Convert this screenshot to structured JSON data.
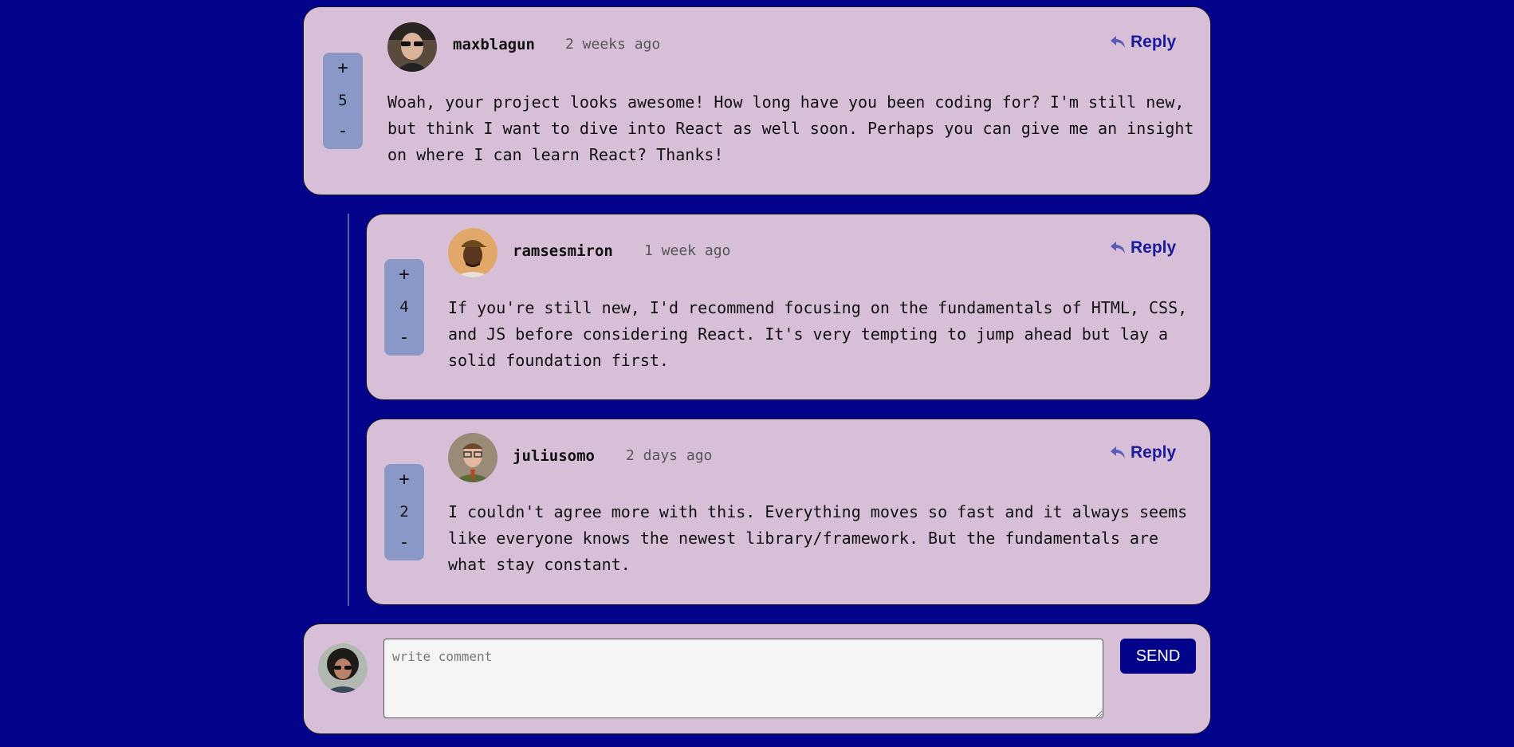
{
  "comments": [
    {
      "username": "maxblagun",
      "timestamp": "2 weeks ago",
      "score": "5",
      "upvote": "+",
      "downvote": "-",
      "reply_label": "Reply",
      "content": "Woah, your project looks awesome! How long have you been coding for? I'm still new, but think I want to dive into React as well soon. Perhaps you can give me an insight on where I can learn React? Thanks!"
    }
  ],
  "replies": [
    {
      "username": "ramsesmiron",
      "timestamp": "1 week ago",
      "score": "4",
      "upvote": "+",
      "downvote": "-",
      "reply_label": "Reply",
      "content": "If you're still new, I'd recommend focusing on the fundamentals of HTML, CSS, and JS before considering React. It's very tempting to jump ahead but lay a solid foundation first."
    },
    {
      "username": "juliusomo",
      "timestamp": "2 days ago",
      "score": "2",
      "upvote": "+",
      "downvote": "-",
      "reply_label": "Reply",
      "content": "I couldn't agree more with this. Everything moves so fast and it always seems like everyone knows the newest library/framework. But the fundamentals are what stay constant."
    }
  ],
  "composer": {
    "placeholder": "write comment",
    "value": "",
    "send_label": "SEND"
  },
  "colors": {
    "background": "#03038c",
    "card": "#d8bfd8",
    "vote_box": "#8a98c8",
    "reply_text": "#1a1a9a"
  }
}
